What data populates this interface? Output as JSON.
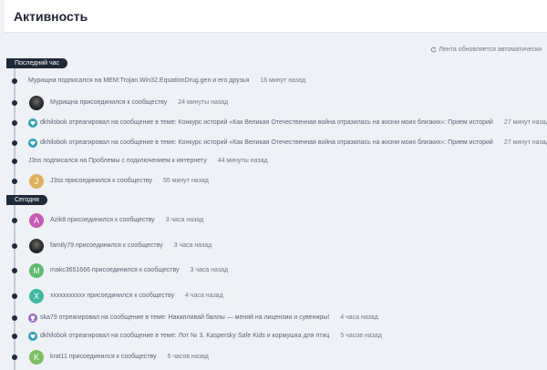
{
  "header": {
    "title": "Активность"
  },
  "refresh": {
    "label": "Лента обновляется автоматически",
    "icon": "refresh-icon"
  },
  "sections": [
    {
      "label": "Последний час"
    },
    {
      "label": "Сегодня"
    }
  ],
  "items": [
    {
      "text": "Мурищна подписался на MEM:Trojan.Win32.EquationDrug.gen и его друзья",
      "time": "16 минут назад",
      "avatar": "none"
    },
    {
      "text": "Мурищна присоединился к сообществу",
      "time": "24 минуты назад",
      "avatar": "photo-dark"
    },
    {
      "text": "dkhilobok отреагировал на сообщение в теме: Конкурс историй «Как Великая Отечественная война отразилась на жизни моих близких»: Прием историй",
      "time": "27 минут назад",
      "avatar": "heart"
    },
    {
      "text": "dkhilobok отреагировал на сообщение в теме: Конкурс историй «Как Великая Отечественная война отразилась на жизни моих близких»: Прием историй",
      "time": "27 минут назад",
      "avatar": "heart"
    },
    {
      "text": "J3ss подписался на Проблемы с подключением к интернету",
      "time": "44 минуты назад",
      "avatar": "none"
    },
    {
      "text": "J3ss присоединился к сообществу",
      "time": "55 минут назад",
      "avatar": "J",
      "color": "#e0b15c"
    },
    {
      "text": "Azik8 присоединился к сообществу",
      "time": "3 часа назад",
      "avatar": "A",
      "color": "#c65ab4"
    },
    {
      "text": "family79 присоединился к сообществу",
      "time": "3 часа назад",
      "avatar": "photo-dark"
    },
    {
      "text": "makc3651666 присоединился к сообществу",
      "time": "3 часа назад",
      "avatar": "M",
      "color": "#5dbb6e"
    },
    {
      "text": "xxxxxxxxxxx присоединился к сообществу",
      "time": "4 часа назад",
      "avatar": "X",
      "color": "#3fb8a4"
    },
    {
      "text": "ska79 отреагировал на сообщение в теме: Накапливай баллы — меняй на лицензии и сувениры!",
      "time": "4 часа назад",
      "avatar": "trophy"
    },
    {
      "text": "dkhilobok отреагировал на сообщение в теме: Лот № 3. Kaspersky Safe Kids и кормушка для птиц",
      "time": "5 часов назад",
      "avatar": "heart"
    },
    {
      "text": "krat11 присоединился к сообществу",
      "time": "5 часов назад",
      "avatar": "K",
      "color": "#7cbf62"
    }
  ],
  "colors": {
    "heart": "#2a9fb5",
    "trophy": "#9b6bc6",
    "timeline": "#1e2a3a"
  }
}
